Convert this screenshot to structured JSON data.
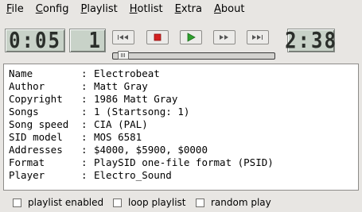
{
  "menu": [
    "File",
    "Config",
    "Playlist",
    "Hotlist",
    "Extra",
    "About"
  ],
  "player": {
    "elapsed": "0:05",
    "song_number": "1",
    "total": "2:38",
    "position_fraction": 0.03
  },
  "controls": [
    {
      "name": "prev-song-button",
      "icon": "skip-back-icon"
    },
    {
      "name": "stop-button",
      "icon": "stop-icon",
      "color": "#d42121"
    },
    {
      "name": "play-button",
      "icon": "play-icon",
      "color": "#2fa12f"
    },
    {
      "name": "forward-button",
      "icon": "fast-forward-icon"
    },
    {
      "name": "next-song-button",
      "icon": "skip-forward-icon"
    }
  ],
  "info": [
    {
      "label": "Name",
      "value": "Electrobeat"
    },
    {
      "label": "Author",
      "value": "Matt Gray"
    },
    {
      "label": "Copyright",
      "value": "1986 Matt Gray"
    },
    {
      "label": "Songs",
      "value": "1 (Startsong: 1)"
    },
    {
      "label": "Song speed",
      "value": "CIA (PAL)"
    },
    {
      "label": "SID model",
      "value": "MOS 6581"
    },
    {
      "label": "Addresses",
      "value": "$4000, $5900, $0000"
    },
    {
      "label": "Format",
      "value": "PlaySID one-file format (PSID)"
    },
    {
      "label": "Player",
      "value": "Electro_Sound"
    }
  ],
  "separator": ":",
  "options": {
    "playlist_enabled": "playlist enabled",
    "loop_playlist": "loop playlist",
    "random_play": "random play"
  }
}
